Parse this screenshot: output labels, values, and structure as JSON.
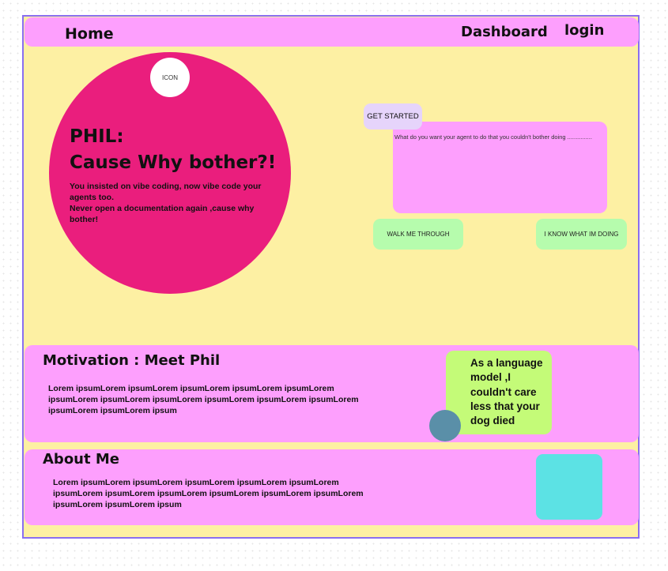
{
  "nav": {
    "home": "Home",
    "dashboard": "Dashboard",
    "login": "login"
  },
  "hero": {
    "icon_label": "ICON",
    "title": "PHIL:",
    "subtitle": "Cause Why bother?!",
    "lines": [
      "You insisted on vibe coding, now vibe code your agents too.",
      "Never open a documentation again ,cause why bother!"
    ]
  },
  "agent": {
    "get_started": "GET STARTED",
    "prompt_placeholder": "What do you want your agent to do that you couldn't bother doing ...............",
    "walk_button": "WALK ME THROUGH",
    "know_button": "I KNOW WHAT IM DOING"
  },
  "motivation": {
    "title": "Motivation : Meet Phil",
    "body": "Lorem ipsumLorem ipsumLorem ipsumLorem ipsumLorem ipsumLorem ipsumLorem ipsumLorem ipsumLorem ipsumLorem ipsumLorem ipsumLorem ipsumLorem ipsumLorem ipsum",
    "quote": "As a language model ,I couldn't care less that your dog died"
  },
  "about": {
    "title": "About Me",
    "body": "Lorem ipsumLorem ipsumLorem ipsumLorem ipsumLorem ipsumLorem ipsumLorem ipsumLorem ipsumLorem ipsumLorem ipsumLorem ipsumLorem ipsumLorem ipsumLorem ipsum"
  },
  "colors": {
    "nav_bg": "#fd9ffd",
    "page_bg": "#fdf0a3",
    "hero_circle": "#ea1e7d",
    "button_green": "#b6fcad",
    "quote_bg": "#c4fb78",
    "about_image": "#5ce2e4",
    "frame_border": "#8a6ff0"
  }
}
